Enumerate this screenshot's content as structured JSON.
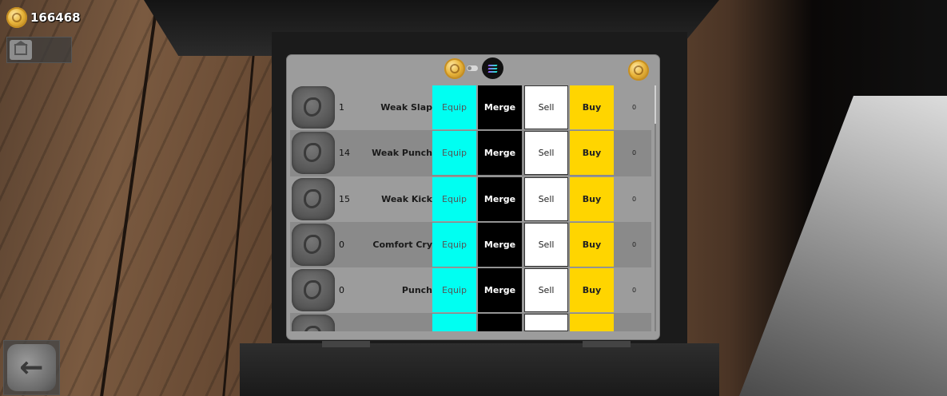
{
  "hud": {
    "currency_amount": "166468",
    "currency_icon": "gold-coin-icon",
    "home_icon": "house-icon",
    "back_icon": "back-arrow-icon"
  },
  "shop": {
    "header_icons": [
      "gold-coin-icon",
      "toggle-switch",
      "solana-icon",
      "gold-coin-icon"
    ],
    "rows": [
      {
        "level": "1",
        "name": "Weak Slap",
        "equip": "Equip",
        "merge": "Merge",
        "sell": "Sell",
        "buy": "Buy",
        "count": "0"
      },
      {
        "level": "14",
        "name": "Weak Punch",
        "equip": "Equip",
        "merge": "Merge",
        "sell": "Sell",
        "buy": "Buy",
        "count": "0"
      },
      {
        "level": "15",
        "name": "Weak Kick",
        "equip": "Equip",
        "merge": "Merge",
        "sell": "Sell",
        "buy": "Buy",
        "count": "0"
      },
      {
        "level": "0",
        "name": "Comfort Cry",
        "equip": "Equip",
        "merge": "Merge",
        "sell": "Sell",
        "buy": "Buy",
        "count": "0"
      },
      {
        "level": "0",
        "name": "Punch",
        "equip": "Equip",
        "merge": "Merge",
        "sell": "Sell",
        "buy": "Buy",
        "count": "0"
      }
    ]
  },
  "colors": {
    "equip": "#00fff2",
    "merge": "#000000",
    "sell": "#ffffff",
    "buy": "#ffd500",
    "panel": "#9c9c9c"
  }
}
